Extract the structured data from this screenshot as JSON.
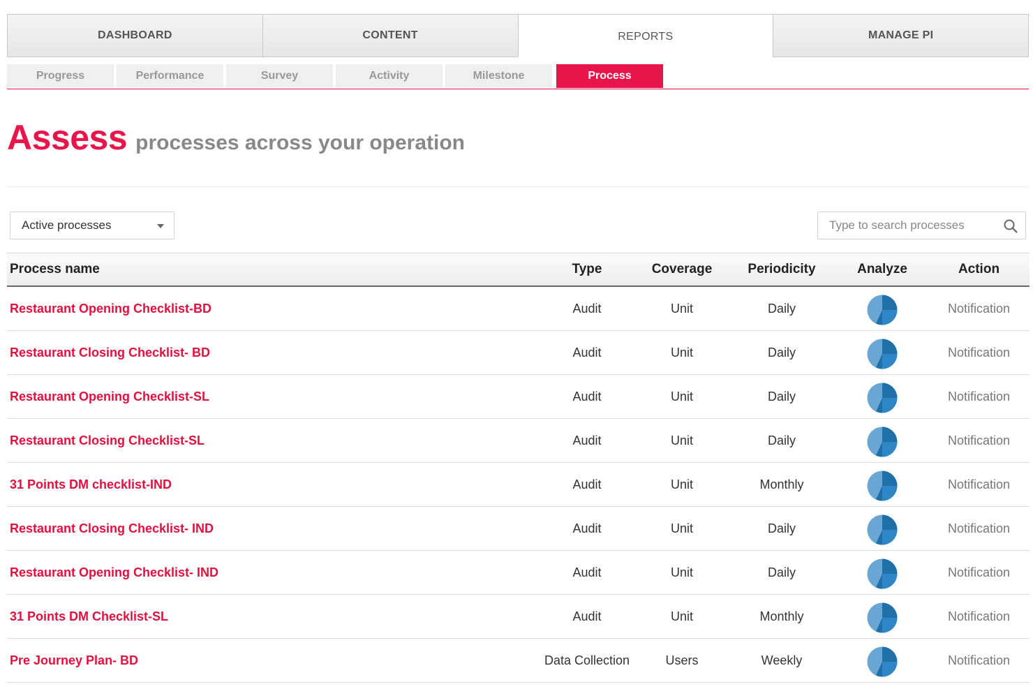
{
  "main_tabs": [
    {
      "label": "DASHBOARD",
      "active": false
    },
    {
      "label": "CONTENT",
      "active": false
    },
    {
      "label": "REPORTS",
      "active": true
    },
    {
      "label": "MANAGE PI",
      "active": false
    }
  ],
  "sub_tabs": [
    {
      "label": "Progress",
      "active": false
    },
    {
      "label": "Performance",
      "active": false
    },
    {
      "label": "Survey",
      "active": false
    },
    {
      "label": "Activity",
      "active": false
    },
    {
      "label": "Milestone",
      "active": false
    },
    {
      "label": "Process",
      "active": true
    }
  ],
  "page": {
    "title_main": "Assess",
    "title_sub": "processes across your operation"
  },
  "filter": {
    "selected": "Active processes",
    "icon": "chevron-down-icon"
  },
  "search": {
    "placeholder": "Type to search processes",
    "value": "",
    "icon": "search-icon"
  },
  "table": {
    "headers": {
      "name": "Process name",
      "type": "Type",
      "coverage": "Coverage",
      "periodicity": "Periodicity",
      "analyze": "Analyze",
      "action": "Action"
    },
    "rows": [
      {
        "name": "Restaurant Opening Checklist-BD",
        "type": "Audit",
        "coverage": "Unit",
        "periodicity": "Daily",
        "analyze_icon": "pie-chart-icon",
        "action": "Notification"
      },
      {
        "name": "Restaurant Closing Checklist- BD",
        "type": "Audit",
        "coverage": "Unit",
        "periodicity": "Daily",
        "analyze_icon": "pie-chart-icon",
        "action": "Notification"
      },
      {
        "name": "Restaurant Opening Checklist-SL",
        "type": "Audit",
        "coverage": "Unit",
        "periodicity": "Daily",
        "analyze_icon": "pie-chart-icon",
        "action": "Notification"
      },
      {
        "name": "Restaurant Closing Checklist-SL",
        "type": "Audit",
        "coverage": "Unit",
        "periodicity": "Daily",
        "analyze_icon": "pie-chart-icon",
        "action": "Notification"
      },
      {
        "name": "31 Points DM checklist-IND",
        "type": "Audit",
        "coverage": "Unit",
        "periodicity": "Monthly",
        "analyze_icon": "pie-chart-icon",
        "action": "Notification"
      },
      {
        "name": "Restaurant Closing Checklist- IND",
        "type": "Audit",
        "coverage": "Unit",
        "periodicity": "Daily",
        "analyze_icon": "pie-chart-icon",
        "action": "Notification"
      },
      {
        "name": "Restaurant Opening Checklist- IND",
        "type": "Audit",
        "coverage": "Unit",
        "periodicity": "Daily",
        "analyze_icon": "pie-chart-icon",
        "action": "Notification"
      },
      {
        "name": "31 Points DM Checklist-SL",
        "type": "Audit",
        "coverage": "Unit",
        "periodicity": "Monthly",
        "analyze_icon": "pie-chart-icon",
        "action": "Notification"
      },
      {
        "name": "Pre Journey Plan- BD",
        "type": "Data Collection",
        "coverage": "Users",
        "periodicity": "Weekly",
        "analyze_icon": "pie-chart-icon",
        "action": "Notification"
      }
    ]
  },
  "colors": {
    "accent": "#e8154b",
    "link": "#e0103f",
    "pie_dark": "#1f6fa8",
    "pie_light": "#6aa6d3",
    "pie_mid": "#2f86c4"
  }
}
